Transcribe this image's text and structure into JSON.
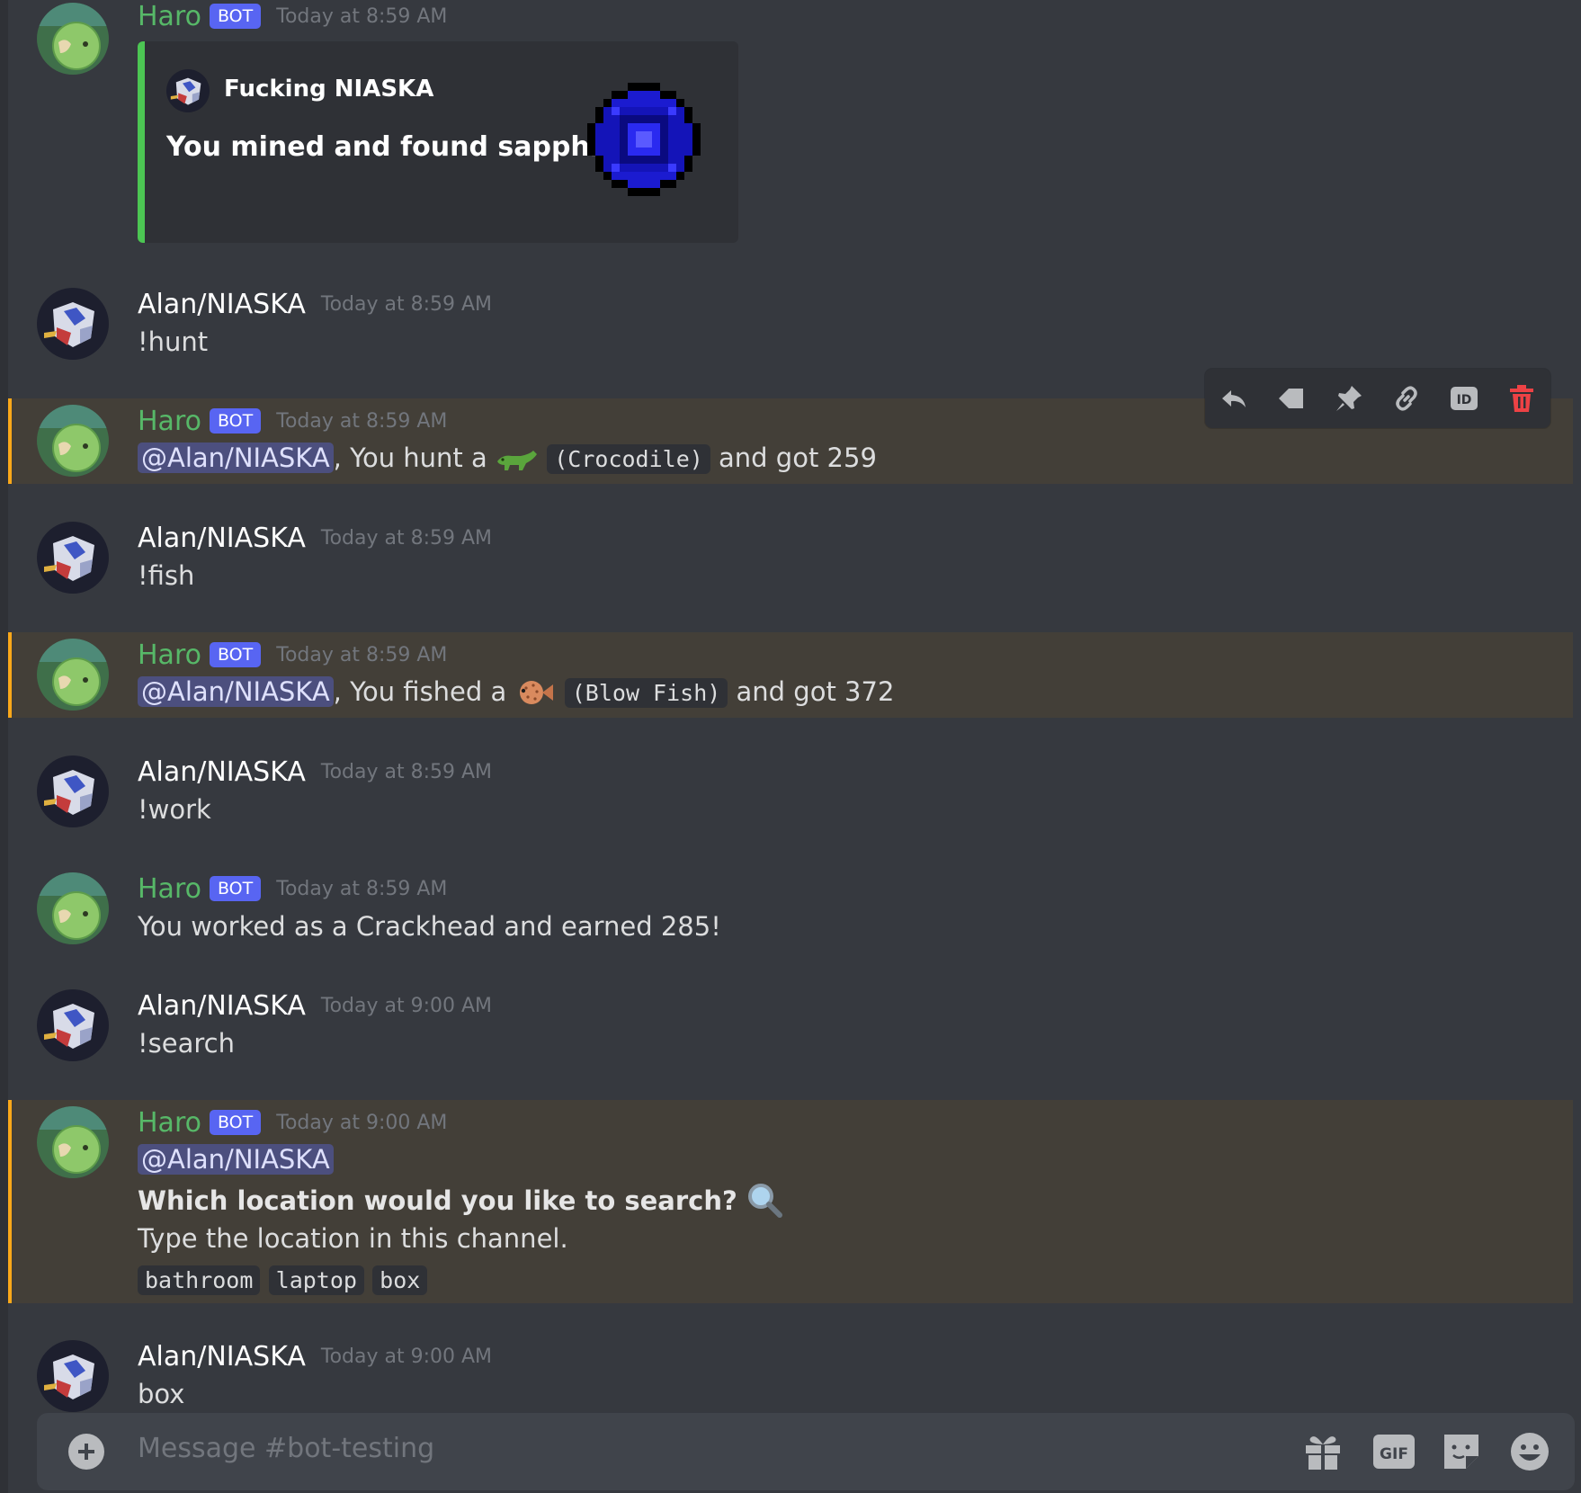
{
  "channel": {
    "composer_placeholder": "Message #bot-testing"
  },
  "colors": {
    "background": "#36393f",
    "bot_name": "#57b868",
    "bot_badge": "#5865f2",
    "mention_highlight": "#faa81a",
    "embed_accent": "#4cc653",
    "delete_icon": "#ed4245"
  },
  "messages": [
    {
      "author": "Haro",
      "badge": "BOT",
      "time": "Today at 8:59 AM",
      "embed": {
        "author": "Fucking NIASKA",
        "description": "You mined and found sapphire"
      }
    },
    {
      "author": "Alan/NIASKA",
      "time": "Today at 8:59 AM",
      "text": "!hunt"
    },
    {
      "author": "Haro",
      "badge": "BOT",
      "time": "Today at 8:59 AM",
      "mention": "@Alan/NIASKA",
      "pre": ", You hunt a",
      "code": "(Crocodile)",
      "post": "and got 259"
    },
    {
      "author": "Alan/NIASKA",
      "time": "Today at 8:59 AM",
      "text": "!fish"
    },
    {
      "author": "Haro",
      "badge": "BOT",
      "time": "Today at 8:59 AM",
      "mention": "@Alan/NIASKA",
      "pre": ", You fished a",
      "code": "(Blow Fish)",
      "post": "and got 372"
    },
    {
      "author": "Alan/NIASKA",
      "time": "Today at 8:59 AM",
      "text": "!work"
    },
    {
      "author": "Haro",
      "badge": "BOT",
      "time": "Today at 8:59 AM",
      "text": "You worked as a Crackhead and earned 285!"
    },
    {
      "author": "Alan/NIASKA",
      "time": "Today at 9:00 AM",
      "text": "!search"
    },
    {
      "author": "Haro",
      "badge": "BOT",
      "time": "Today at 9:00 AM",
      "mention": "@Alan/NIASKA",
      "question": "Which location would you like to search?",
      "instruction": "Type the location in this channel.",
      "options": [
        "bathroom",
        "laptop",
        "box"
      ]
    },
    {
      "author": "Alan/NIASKA",
      "time": "Today at 9:00 AM",
      "text": "box"
    }
  ],
  "toolbar_icons": [
    "reply-icon",
    "tag-icon",
    "pin-icon",
    "link-icon",
    "id-icon",
    "trash-icon"
  ],
  "composer_icons": [
    "plus-icon",
    "gift-icon",
    "gif-icon",
    "sticker-icon",
    "emoji-icon"
  ],
  "gif_label": "GIF",
  "id_label": "ID"
}
